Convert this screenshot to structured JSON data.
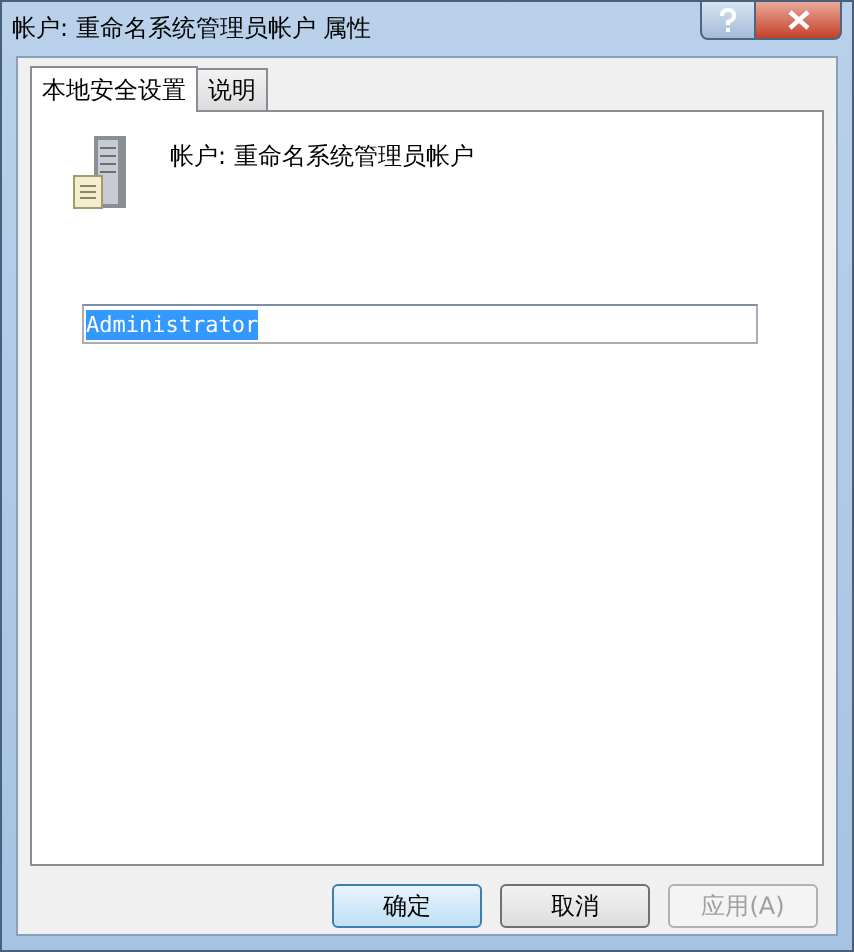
{
  "window": {
    "title": "帐户: 重命名系统管理员帐户 属性"
  },
  "tabs": [
    {
      "label": "本地安全设置",
      "selected": true
    },
    {
      "label": "说明",
      "selected": false
    }
  ],
  "policy": {
    "name": "帐户: 重命名系统管理员帐户"
  },
  "field": {
    "value": "Administrator",
    "text_selected": true
  },
  "buttons": [
    {
      "label": "确定",
      "kind": "default",
      "disabled": false
    },
    {
      "label": "取消",
      "kind": "normal",
      "disabled": false
    },
    {
      "label": "应用(A)",
      "kind": "normal",
      "disabled": true
    }
  ]
}
